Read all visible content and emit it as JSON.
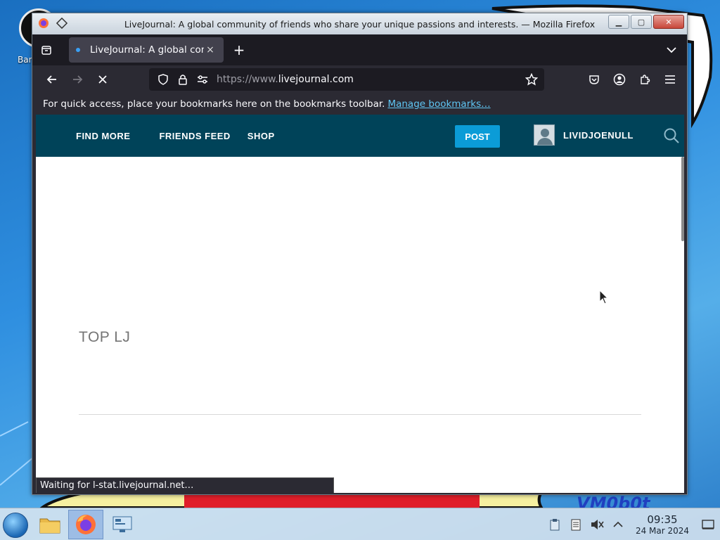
{
  "window": {
    "title": "LiveJournal: A global community of friends who share your unique passions and interests. — Mozilla Firefox"
  },
  "desktop": {
    "icon_label": "Bar"
  },
  "tabs": [
    {
      "title": "LiveJournal: A global community of friends who share your unique passions and interests.",
      "close": "×"
    }
  ],
  "newtab_label": "+",
  "urlbar": {
    "scheme_prefix": "https://www.",
    "host": "livejournal.com"
  },
  "bookmarks_bar": {
    "message": "For quick access, place your bookmarks here on the bookmarks toolbar.",
    "link": "Manage bookmarks…"
  },
  "site": {
    "nav": [
      "FIND MORE",
      "FRIENDS FEED",
      "SHOP"
    ],
    "post_button": "POST",
    "username": "LIVIDJOENULL",
    "section_title": "TOP LJ",
    "header_color": "#004359",
    "accent_color": "#0b9cd7"
  },
  "statusbar": {
    "text": "Waiting for l-stat.livejournal.net…"
  },
  "taskbar": {
    "time": "09:35",
    "date": "24 Mar 2024"
  }
}
